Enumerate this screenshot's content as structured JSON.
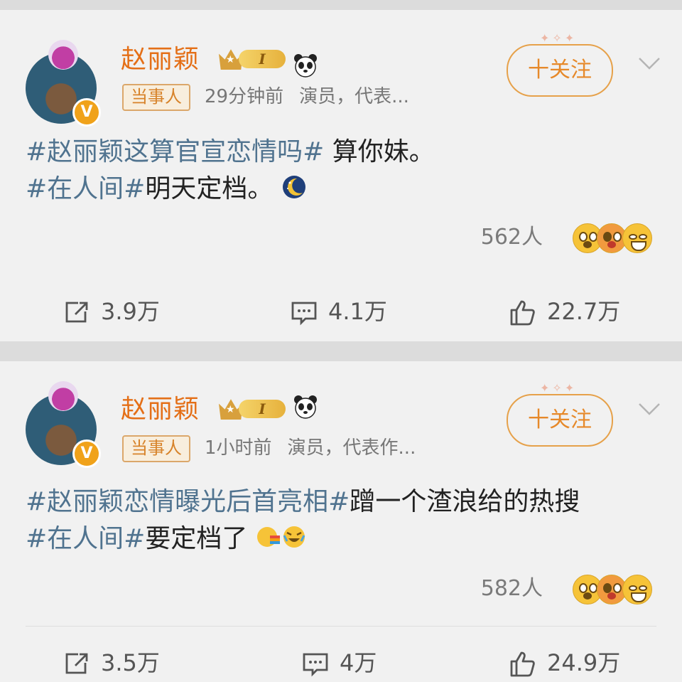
{
  "posts": [
    {
      "username": "赵丽颖",
      "level": "I",
      "tag": "当事人",
      "time": "29分钟前",
      "bio": "演员，代表...",
      "follow_label": "十关注",
      "line1_topic": "#赵丽颖这算官宣恋情吗#",
      "line1_text": " 算你妹。",
      "line2_topic": "#在人间#",
      "line2_text": "明天定档。",
      "reaction_count": "562人",
      "share": "3.9万",
      "comment": "4.1万",
      "like": "22.7万"
    },
    {
      "username": "赵丽颖",
      "level": "I",
      "tag": "当事人",
      "time": "1小时前",
      "bio": "演员，代表作...",
      "follow_label": "十关注",
      "line1_topic": "#赵丽颖恋情曝光后首亮相#",
      "line1_text": "蹭一个渣浪给的热搜",
      "line2_topic": "#在人间#",
      "line2_text": "要定档了",
      "reaction_count": "582人",
      "share": "3.5万",
      "comment": "4万",
      "like": "24.9万"
    }
  ],
  "colors": {
    "username": "#e46f17",
    "topic": "#50738f",
    "follow": "#e6892a",
    "card_bg": "#f1f1f1",
    "separator_bg": "#dcdcdc"
  },
  "icons": [
    "crown-icon",
    "panda-icon",
    "chevron-down-icon",
    "moon-emoji-icon",
    "laugh-cry-emoji-icon",
    "surprised-face-icon",
    "wink-face-icon",
    "grin-face-icon",
    "share-icon",
    "comment-icon",
    "like-icon"
  ]
}
